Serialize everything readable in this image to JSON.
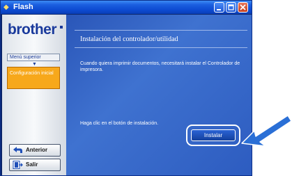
{
  "window": {
    "title": "Flash",
    "controls": [
      "minimize-icon",
      "maximize-icon",
      "close-icon"
    ]
  },
  "sidebar": {
    "logo": "brother",
    "menu_top": "Menú superior",
    "menu_active": "Configuración inicial",
    "back_label": "Anterior",
    "exit_label": "Salir"
  },
  "main": {
    "title": "Instalación del controlador/utilidad",
    "description": "Cuando quiera imprimir documentos, necesitará instalar el Controlador de impresora.",
    "hint": "Haga clic en el botón de instalación.",
    "install_label": "Instalar"
  },
  "colors": {
    "titlebar": "#1c5fe0",
    "content_bg": "#3f72d0",
    "menu_active_bg": "#f7a81b",
    "logo": "#1a3a9c",
    "pointer_arrow": "#2a6fd6"
  },
  "icons": {
    "app": "flash-app-icon",
    "back": "back-arrow-icon",
    "exit": "exit-door-icon",
    "pointer": "pointer-arrow-icon"
  }
}
